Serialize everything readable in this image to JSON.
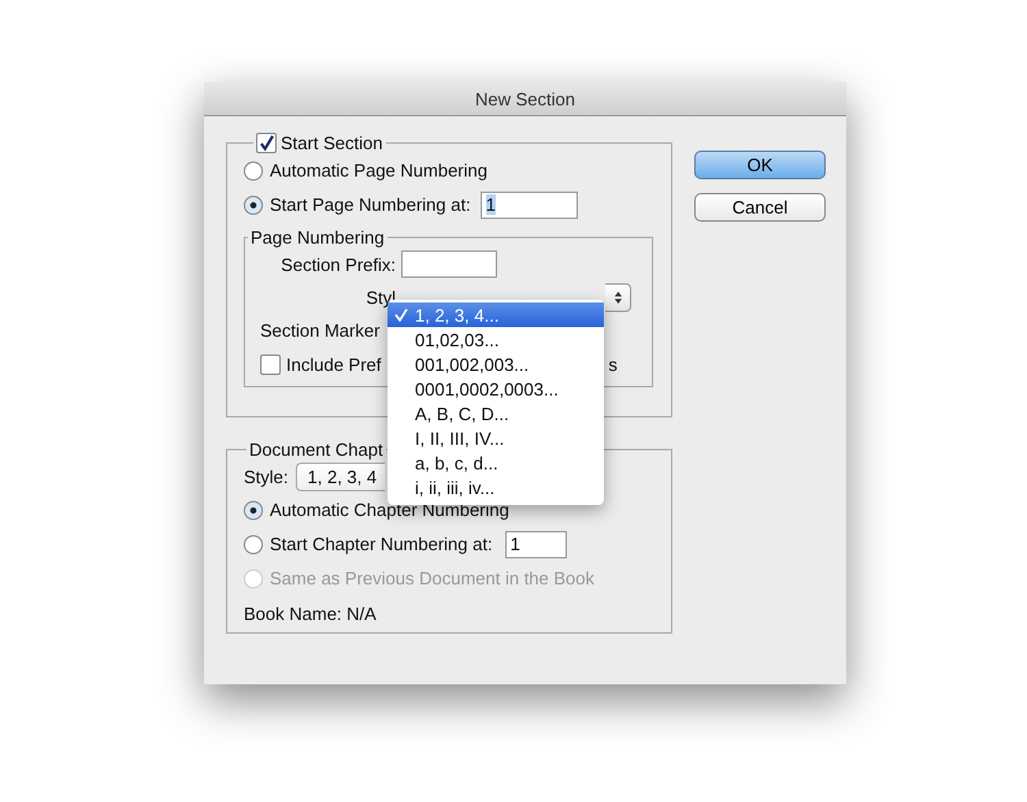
{
  "window": {
    "title": "New Section"
  },
  "start_section": {
    "label": "Start Section",
    "checked": true,
    "options": [
      {
        "label": "Automatic Page Numbering",
        "selected": false
      },
      {
        "label": "Start Page Numbering at:",
        "selected": true,
        "value": "1"
      }
    ],
    "page_numbering": {
      "title": "Page Numbering",
      "prefix_label": "Section Prefix:",
      "style_label": "Styl",
      "marker_label": "Section Marker",
      "include": {
        "label": "Include Pref",
        "tail": "s",
        "checked": false
      }
    }
  },
  "style_menu": {
    "items": [
      {
        "label": "1, 2, 3, 4...",
        "selected": true
      },
      {
        "label": "01,02,03...",
        "selected": false
      },
      {
        "label": "001,002,003...",
        "selected": false
      },
      {
        "label": "0001,0002,0003...",
        "selected": false
      },
      {
        "label": "A, B, C, D...",
        "selected": false
      },
      {
        "label": "I, II, III, IV...",
        "selected": false
      },
      {
        "label": "a, b, c, d...",
        "selected": false
      },
      {
        "label": "i, ii, iii, iv...",
        "selected": false
      }
    ]
  },
  "document_chapter": {
    "title": "Document Chapt",
    "style_label": "Style:",
    "style_value": "1, 2, 3, 4",
    "options": [
      {
        "label": "Automatic Chapter Numbering",
        "selected": true,
        "disabled": false
      },
      {
        "label": "Start Chapter Numbering at:",
        "selected": false,
        "disabled": false,
        "value": "1"
      },
      {
        "label": "Same as Previous Document in the Book",
        "selected": false,
        "disabled": true
      }
    ],
    "book_name": "Book Name: N/A"
  },
  "buttons": [
    {
      "label": "OK",
      "default": true
    },
    {
      "label": "Cancel",
      "default": false
    }
  ]
}
